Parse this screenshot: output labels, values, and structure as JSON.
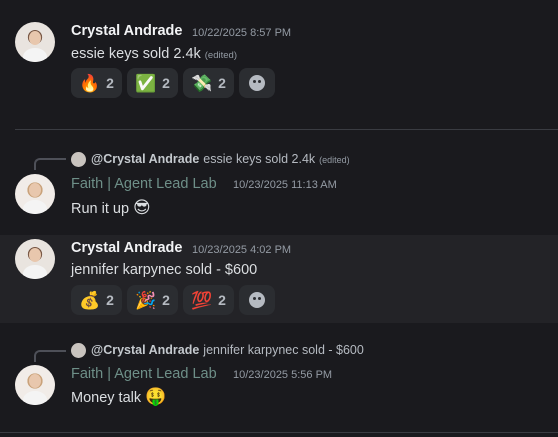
{
  "messages": [
    {
      "author": "Crystal Andrade",
      "timestamp": "10/22/2025 8:57 PM",
      "text": "essie keys sold 2.4k",
      "edited": "(edited)",
      "reactions": [
        {
          "emoji": "🔥",
          "count": "2"
        },
        {
          "emoji": "✅",
          "count": "2"
        },
        {
          "emoji": "💸",
          "count": "2"
        }
      ]
    },
    {
      "reply_to": {
        "mention": "@Crystal Andrade",
        "text": "essie keys sold 2.4k",
        "edited": "(edited)"
      },
      "author": "Faith | Agent Lead Lab",
      "timestamp": "10/23/2025 11:13 AM",
      "text": "Run it up",
      "emoji": "😎"
    },
    {
      "author": "Crystal Andrade",
      "timestamp": "10/23/2025 4:02 PM",
      "text": "jennifer karpynec sold - $600",
      "reactions": [
        {
          "emoji": "💰",
          "count": "2"
        },
        {
          "emoji": "🎉",
          "count": "2"
        },
        {
          "emoji": "💯",
          "count": "2"
        }
      ]
    },
    {
      "reply_to": {
        "mention": "@Crystal Andrade",
        "text": "jennifer karpynec sold - $600"
      },
      "author": "Faith | Agent Lead Lab",
      "timestamp": "10/23/2025 5:56 PM",
      "text": "Money talk",
      "emoji": "🤑"
    }
  ],
  "icons": {
    "add_reaction": "add-reaction-icon",
    "reply": "reply-arrow-icon"
  },
  "colors": {
    "background": "#1a1a1e",
    "highlight": "#232327",
    "role_name": "#6e8f88",
    "reaction_bg": "#2b2d31"
  }
}
